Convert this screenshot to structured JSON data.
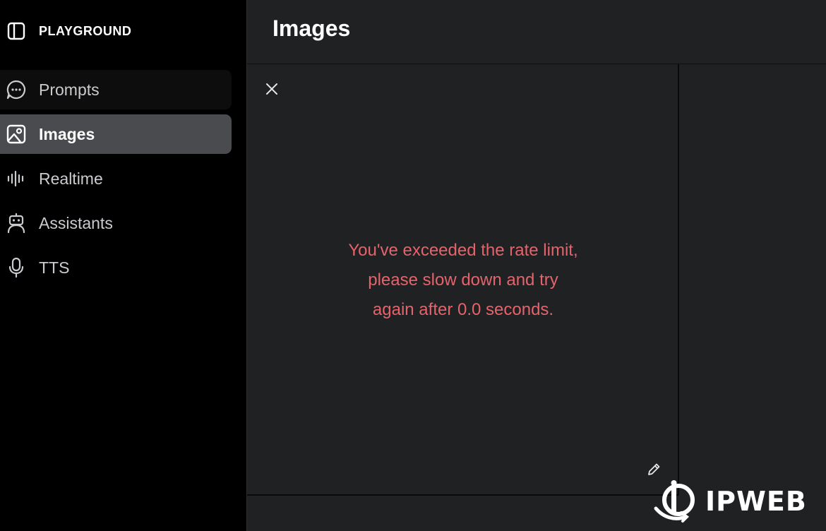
{
  "brand": {
    "label": "PLAYGROUND",
    "icon": "sidebar-panel-icon"
  },
  "nav": {
    "items": [
      {
        "label": "Prompts",
        "icon": "chat-bubble-icon",
        "state": "hover"
      },
      {
        "label": "Images",
        "icon": "image-icon",
        "state": "active"
      },
      {
        "label": "Realtime",
        "icon": "waveform-icon",
        "state": "default"
      },
      {
        "label": "Assistants",
        "icon": "robot-icon",
        "state": "default"
      },
      {
        "label": "TTS",
        "icon": "microphone-icon",
        "state": "default"
      }
    ]
  },
  "main": {
    "title": "Images",
    "error": {
      "line1": "You've exceeded the rate limit,",
      "line2": "please slow down and try",
      "line3": "again after 0.0 seconds."
    }
  },
  "watermark": {
    "text": "IPWEB"
  },
  "colors": {
    "sidebar_bg": "#000000",
    "main_bg": "#202123",
    "active_item_bg": "#4a4b4f",
    "error_text": "#e5636b"
  }
}
